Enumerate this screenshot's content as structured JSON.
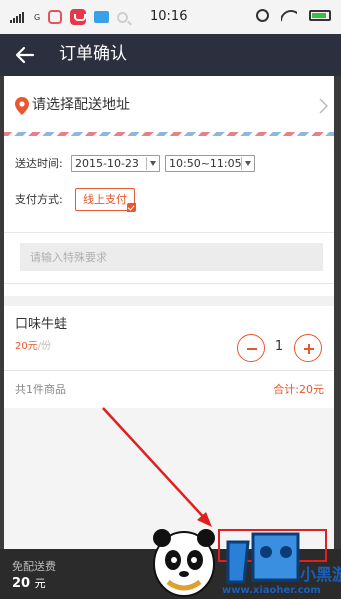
{
  "status_bar": {
    "network": "G",
    "time": "10:16",
    "icons": [
      "signal-icon",
      "weibo-icon",
      "tmall-icon",
      "mail-icon",
      "search-icon",
      "alarm-icon",
      "wifi-icon",
      "battery-icon"
    ]
  },
  "header": {
    "title": "订单确认",
    "back_icon": "back-arrow-icon"
  },
  "address": {
    "label": "请选择配送地址",
    "icon": "location-pin-icon"
  },
  "delivery": {
    "label": "送达时间:",
    "date": "2015-10-23",
    "time_slot": "10:50~11:05"
  },
  "payment": {
    "label": "支付方式:",
    "selected": "线上支付"
  },
  "remark": {
    "placeholder": "请输入特殊要求"
  },
  "item": {
    "name": "口味牛蛙",
    "price": "20元",
    "unit": "/份",
    "quantity": "1"
  },
  "summary": {
    "count_text": "共1件商品",
    "total_text": "合计:20元"
  },
  "footer": {
    "fee_label": "免配送费",
    "fee_amount": "20",
    "fee_unit": "元"
  },
  "watermark": {
    "text": "小黑游戏",
    "url": "www.xiaoher.com"
  },
  "colors": {
    "header_bg": "#2c2f3d",
    "accent": "#e8572f",
    "annotation_red": "#e01f1f"
  }
}
